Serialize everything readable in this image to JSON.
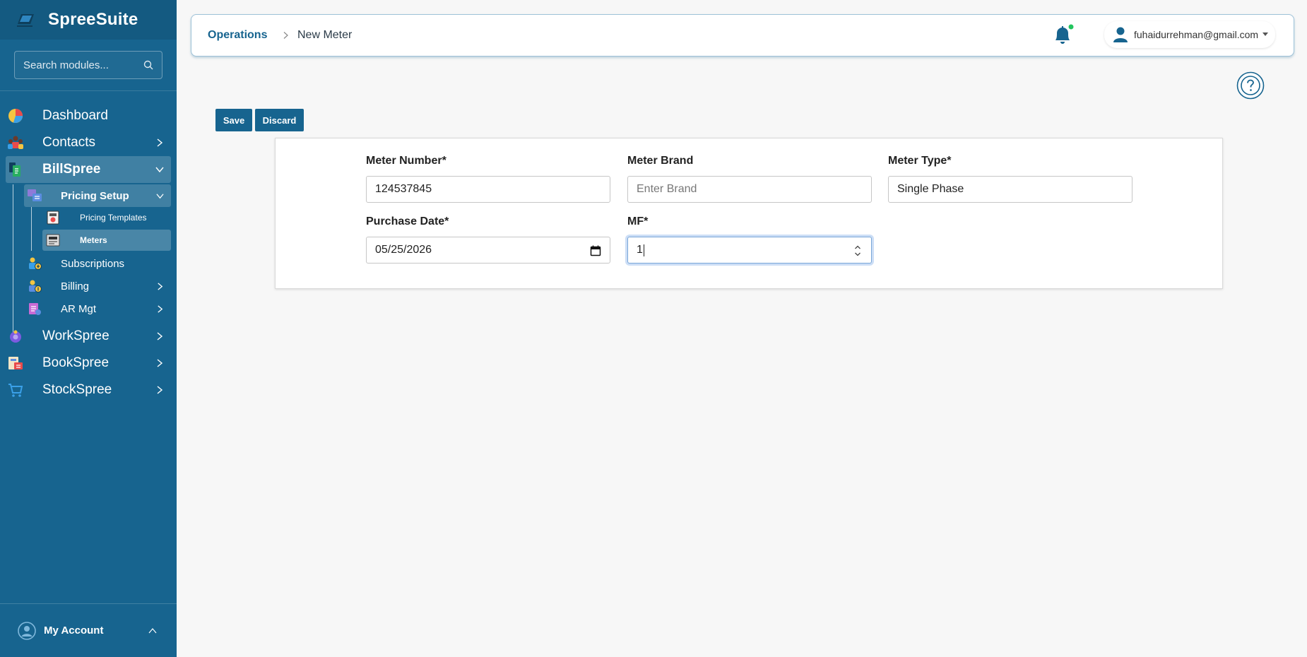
{
  "app": {
    "name": "SpreeSuite"
  },
  "sidebar": {
    "search_placeholder": "Search modules...",
    "items": {
      "dashboard": "Dashboard",
      "contacts": "Contacts",
      "billspree": "BillSpree",
      "pricing_setup": "Pricing Setup",
      "pricing_templates": "Pricing Templates",
      "meters": "Meters",
      "subscriptions": "Subscriptions",
      "billing": "Billing",
      "ar_mgt": "AR Mgt",
      "workspree": "WorkSpree",
      "bookspree": "BookSpree",
      "stockspree": "StockSpree"
    },
    "account_label": "My Account"
  },
  "header": {
    "breadcrumb_root": "Operations",
    "breadcrumb_current": "New Meter",
    "user_email": "fuhaidurrehman@gmail.com",
    "notification_dot_color": "#22c55e"
  },
  "toolbar": {
    "save_label": "Save",
    "discard_label": "Discard"
  },
  "form": {
    "meter_number": {
      "label": "Meter Number*",
      "value": "124537845"
    },
    "meter_brand": {
      "label": "Meter Brand",
      "value": "",
      "placeholder": "Enter Brand"
    },
    "meter_type": {
      "label": "Meter Type*",
      "value": "Single Phase"
    },
    "purchase_date": {
      "label": "Purchase Date*",
      "value": "05/25/2026"
    },
    "mf": {
      "label": "MF*",
      "value": "1"
    }
  },
  "colors": {
    "primary": "#17648f",
    "sidebar": "#17648f"
  }
}
